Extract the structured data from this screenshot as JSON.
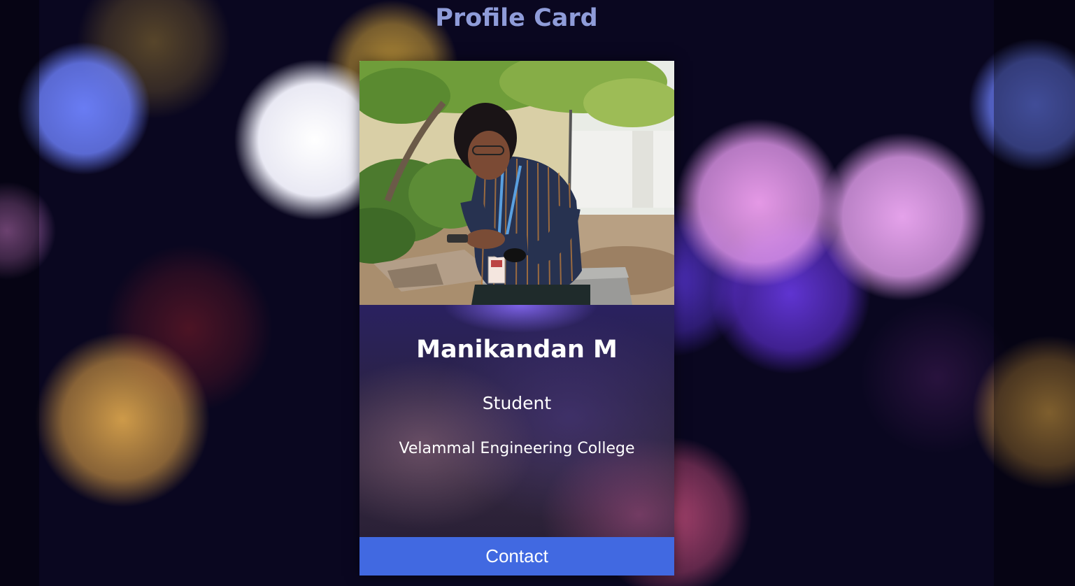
{
  "page": {
    "title": "Profile Card"
  },
  "profile": {
    "photo_alt": "Profile photo",
    "name": "Manikandan M",
    "role": "Student",
    "college": "Velammal Engineering College"
  },
  "socials": [
    {
      "icon": "instagram-icon"
    },
    {
      "icon": "github-icon"
    },
    {
      "icon": "twitter-icon"
    },
    {
      "icon": "linkedin-icon"
    }
  ],
  "actions": {
    "contact_label": "Contact"
  },
  "colors": {
    "title": "#8f9cd9",
    "social_icons": "#d04a98",
    "contact_button": "#4169e1",
    "text": "#ffffff"
  }
}
